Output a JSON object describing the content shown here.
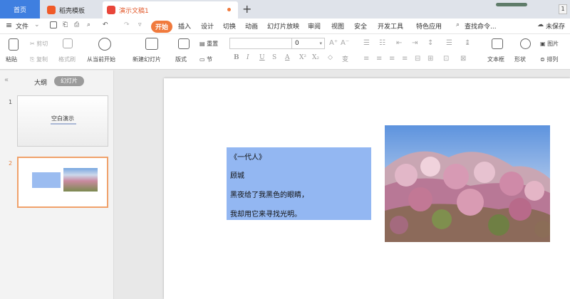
{
  "tabs": {
    "home": "首页",
    "template": "稻壳模板",
    "document": "演示文稿1",
    "plus": "+",
    "corner_num": "1"
  },
  "menu": {
    "hamburger": "≡",
    "file": "文件",
    "items": [
      "开始",
      "插入",
      "设计",
      "切换",
      "动画",
      "幻灯片放映",
      "审阅",
      "视图",
      "安全",
      "开发工具",
      "特色应用"
    ],
    "search": "查找命令...",
    "unsaved": "未保存"
  },
  "ribbon": {
    "paste": "粘贴",
    "cut": "剪切",
    "copy": "复制",
    "format_painter": "格式刷",
    "play_from_current": "从当前开始",
    "new_slide": "新建幻灯片",
    "layout": "版式",
    "reset": "重置",
    "section": "节",
    "font_size": "0",
    "text_box": "文本框",
    "shape": "形状",
    "picture": "图片",
    "arrange": "排列",
    "format_buttons": [
      "B",
      "I",
      "U",
      "S",
      "A",
      "X²",
      "X₂",
      "◇",
      "变"
    ]
  },
  "panel": {
    "collapse": "«",
    "outline_tab": "大纲",
    "slides_tab": "幻灯片",
    "slide1_num": "1",
    "slide1_title": "空白演示",
    "slide2_num": "2"
  },
  "slide": {
    "lines": [
      "《一代人》",
      "顾城",
      "黑夜给了我黑色的眼睛，",
      "我却用它来寻找光明。"
    ]
  },
  "colors": {
    "accent": "#f07a3d",
    "home_tab": "#3f7fe0",
    "text_box_fill": "#93b7f2"
  }
}
